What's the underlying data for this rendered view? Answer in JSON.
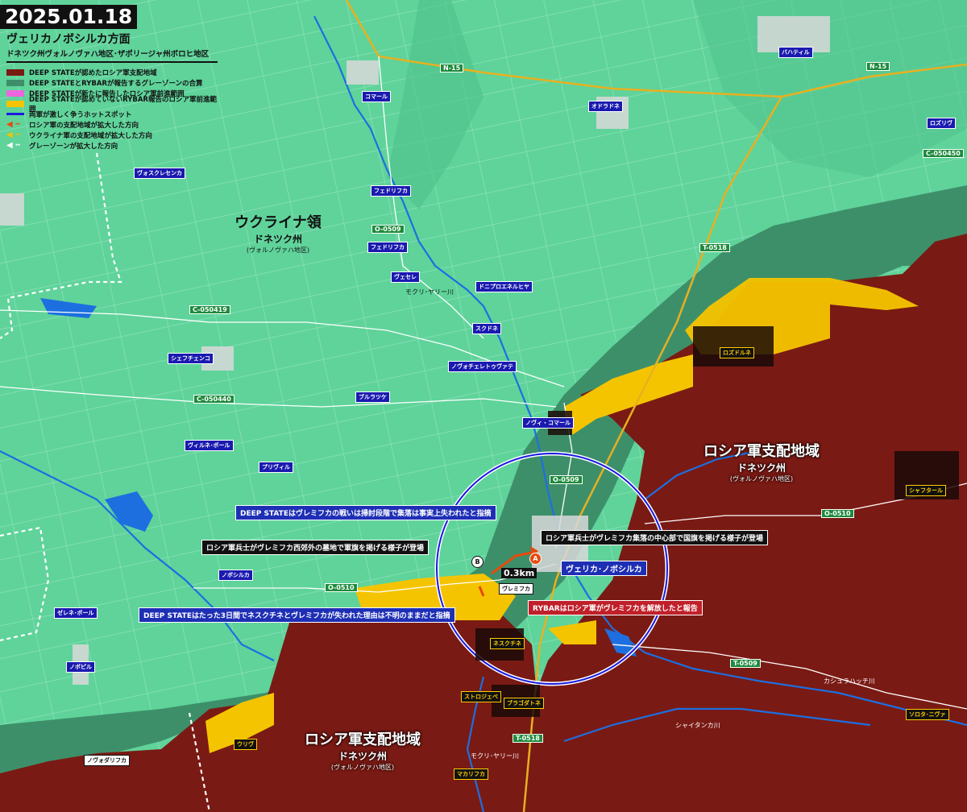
{
  "header": {
    "date": "2025.01.18",
    "title": "ヴェリカノボシルカ方面",
    "subtitle": "ドネツク州ヴォルノヴァハ地区･ザポリージャ州ボロヒ地区"
  },
  "legend": [
    {
      "label": "DEEP STATEが認めたロシア軍支配地域",
      "kind": "fill",
      "color": "#7a1a14"
    },
    {
      "label": "DEEP STATEとRYBARが報告するグレーゾーンの合算",
      "kind": "fill",
      "color": "#3d8f6a"
    },
    {
      "label": "DEEP STATEが新たに報告したロシア軍前進範囲",
      "kind": "fill",
      "color": "#ee66dd"
    },
    {
      "label": "DEEP STATEが認めていないRYBAR報告のロシア軍前進範囲",
      "kind": "fill",
      "color": "#f5c400"
    },
    {
      "label": "両軍が激しく争うホットスポット",
      "kind": "line",
      "color": "#1a1ae0"
    },
    {
      "label": "ロシア軍の支配地域が拡大した方向",
      "kind": "arrow",
      "color": "#e84a0c"
    },
    {
      "label": "ウクライナ軍の支配地域が拡大した方向",
      "kind": "arrow",
      "color": "#f2c200"
    },
    {
      "label": "グレーゾーンが拡大した方向",
      "kind": "arrow",
      "color": "#ffffff"
    }
  ],
  "regions": {
    "ukraine": {
      "big": "ウクライナ領",
      "mid": "ドネツク州",
      "sm": "(ヴォルノヴァハ地区)"
    },
    "russia_east": {
      "big": "ロシア軍支配地域",
      "mid": "ドネツク州",
      "sm": "(ヴォルノヴァハ地区)"
    },
    "russia_south": {
      "big": "ロシア軍支配地域",
      "mid": "ドネツク州",
      "sm": "(ヴォルノヴァハ地区)"
    }
  },
  "roads": {
    "n15_a": "N-15",
    "n15_b": "N-15",
    "t0518_a": "T-0518",
    "t0518_b": "T-0518",
    "t0509": "T-0509",
    "o0509_a": "O-0509",
    "o0509_b": "O-0509",
    "o0510_a": "O-0510",
    "o0510_b": "O-0510",
    "c050419": "C-050419",
    "c050440": "C-050440",
    "c050450": "C-050450"
  },
  "places": {
    "komar": "コマール",
    "batyfyl": "バハティル",
    "odradne": "オドラドネ",
    "rozlyv": "ロズリヴ",
    "vesk": "ヴォスクレセンカ",
    "fedor1": "フェドリフカ",
    "fedor2": "フェドリフカ",
    "vesele": "ヴェセレ",
    "dnipro": "ドニプロエネルヒヤ",
    "skudne": "スクドネ",
    "novoch": "ノヴォチェレトゥヴァテ",
    "shevch": "シェフチェンコ",
    "burlats": "ブルラツケ",
    "novykomar": "ノヴィ・コマール",
    "vilnepole": "ヴィルネ･ポール",
    "pryvilne": "プリヴィル",
    "novosilka": "ノボシルカ",
    "zelenepole": "ゼレネ･ポール",
    "novopil": "ノボピル",
    "rozdolne": "ロズドルネ",
    "shakhtar": "シャフタール",
    "neskuchne": "ネスクチネ",
    "storozheve": "ストロジェベ",
    "blahodatne": "ブラゴダトネ",
    "uriv": "ウリヴ",
    "makarivka": "マカリフカ",
    "zolota": "ソロタ･ニヴァ",
    "novodarivka": "ノヴォダリフカ",
    "vremivka": "ヴレミフカ"
  },
  "rivers": {
    "mokry1": "モクリ･ヤリー川",
    "mokry2": "モクリ･ヤリー川",
    "kashlah": "カシュラハッチ川",
    "shaitanka": "シャイタンカ川"
  },
  "main_town": "ヴェリカ･ノボシルカ",
  "distance": "0.3km",
  "markers": {
    "a": "A",
    "b": "B"
  },
  "callouts": {
    "c1": "DEEP STATEはヴレミフカの戦いは掃討段階で集落は事実上失われたと指摘",
    "c2": "ロシア軍兵士がヴレミフカ西郊外の墓地で軍旗を掲げる様子が登場",
    "c3": "ロシア軍兵士がヴレミフカ集落の中心部で国旗を掲げる様子が登場",
    "c4": "DEEP STATEはたった3日間でネスクチネとヴレミフカが失われた理由は不明のままだと指摘",
    "c5": "RYBARはロシア軍がヴレミフカを解放したと報告"
  },
  "colors": {
    "ukraine": "#5fd39a",
    "russia": "#7a1a14",
    "gray": "#3d8f6a",
    "rybar": "#f5c400",
    "hotspot": "#1a1ae0",
    "road": "#e8b020",
    "river": "#1d6fe0"
  }
}
